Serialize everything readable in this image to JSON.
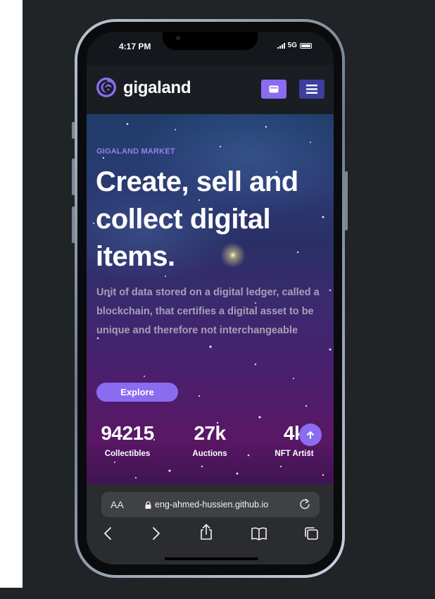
{
  "status_bar": {
    "time": "4:17 PM",
    "network": "5G"
  },
  "header": {
    "brand": "gigaland"
  },
  "hero": {
    "eyebrow": "GIGALAND MARKET",
    "headline": "Create, sell and collect digital items.",
    "description": "Unit of data stored on a digital ledger, called a blockchain, that certifies a digital asset to be unique and therefore not interchangeable",
    "cta_label": "Explore"
  },
  "stats": [
    {
      "value": "94215",
      "label": "Collectibles"
    },
    {
      "value": "27k",
      "label": "Auctions"
    },
    {
      "value": "4k",
      "label": "NFT Artist"
    }
  ],
  "browser": {
    "text_size_label": "AA",
    "url": "eng-ahmed-hussien.github.io"
  },
  "colors": {
    "accent": "#8a6cf0",
    "menu_button": "#3d3e9f",
    "background": "#202427"
  },
  "icons": [
    "swirl-logo-icon",
    "wallet-icon",
    "hamburger-menu-icon",
    "arrow-up-icon",
    "lock-icon",
    "reload-icon",
    "back-icon",
    "forward-icon",
    "share-icon",
    "bookmarks-icon",
    "tabs-icon"
  ]
}
